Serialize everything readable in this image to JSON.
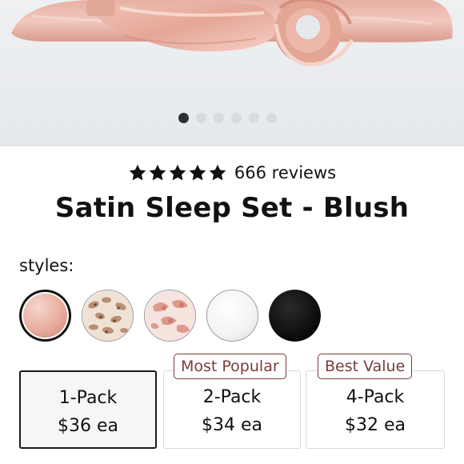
{
  "carousel": {
    "slide_count": 6,
    "active_index": 0
  },
  "rating": {
    "stars": 5,
    "reviews_text": "666 reviews"
  },
  "product": {
    "title": "Satin Sleep Set - Blush"
  },
  "styles": {
    "label": "styles:",
    "swatches": [
      {
        "name": "blush",
        "selected": true
      },
      {
        "name": "leopard",
        "selected": false
      },
      {
        "name": "tie-dye",
        "selected": false
      },
      {
        "name": "white",
        "selected": false
      },
      {
        "name": "black",
        "selected": false
      }
    ]
  },
  "packs": [
    {
      "name": "1-Pack",
      "price": "$36 ea",
      "badge": "",
      "selected": true
    },
    {
      "name": "2-Pack",
      "price": "$34 ea",
      "badge": "Most Popular",
      "selected": false
    },
    {
      "name": "4-Pack",
      "price": "$32 ea",
      "badge": "Best Value",
      "selected": false
    }
  ],
  "colors": {
    "accent_badge": "#7a3b3b",
    "blush": "#e9b1a4",
    "dot_active": "#2b2f36"
  }
}
